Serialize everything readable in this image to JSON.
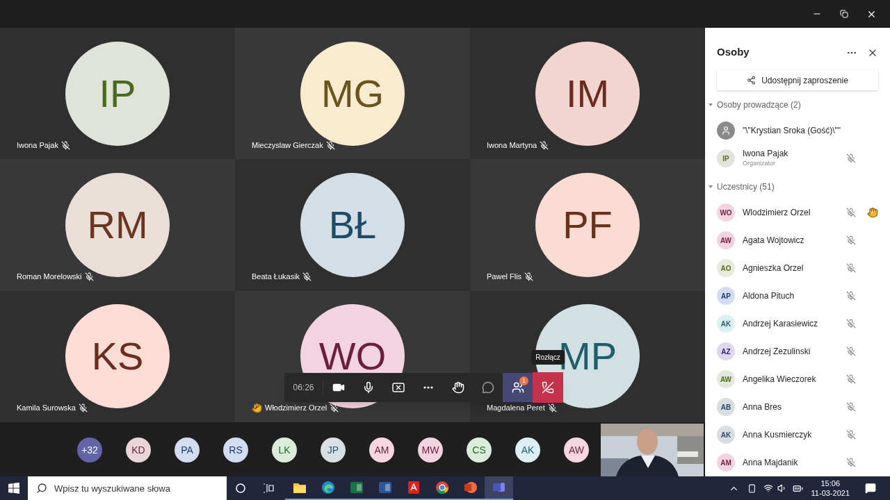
{
  "tiles": [
    {
      "initials": "IP",
      "name": "Iwona Pajak",
      "color": "#dfe3da",
      "muted": true,
      "hand_raised": false
    },
    {
      "initials": "MG",
      "name": "Mieczyslaw Gierczak",
      "color": "#f8ebcf",
      "muted": true,
      "hand_raised": false
    },
    {
      "initials": "IM",
      "name": "Iwona Martyna",
      "color": "#f2d5cf",
      "muted": true,
      "hand_raised": false
    },
    {
      "initials": "RM",
      "name": "Roman Morelowski",
      "color": "#eaded9",
      "muted": true,
      "hand_raised": false
    },
    {
      "initials": "BŁ",
      "name": "Beata Łukasik",
      "color": "#d3dee6",
      "muted": true,
      "hand_raised": false
    },
    {
      "initials": "PF",
      "name": "Pawel Flis",
      "color": "#fbdcd3",
      "muted": true,
      "hand_raised": false
    },
    {
      "initials": "KS",
      "name": "Kamila Surowska",
      "color": "#fcdcd5",
      "muted": true,
      "hand_raised": false
    },
    {
      "initials": "WO",
      "name": "Włodzimierz Orzel",
      "color": "#f4d3e1",
      "muted": true,
      "hand_raised": true
    },
    {
      "initials": "MP",
      "name": "Magdalena Peret",
      "color": "#d2e0e3",
      "muted": true,
      "hand_raised": false
    }
  ],
  "call_controls": {
    "timer": "06:26",
    "tooltip": "Rozłącz",
    "buttons": [
      {
        "kind": "camera",
        "selected": false
      },
      {
        "kind": "mic",
        "selected": false
      },
      {
        "kind": "share",
        "selected": false
      },
      {
        "kind": "more",
        "selected": false
      },
      {
        "kind": "hand",
        "selected": false
      },
      {
        "kind": "chat",
        "selected": false
      },
      {
        "kind": "people",
        "selected": true,
        "badge": "1"
      },
      {
        "kind": "hangup",
        "selected": false
      }
    ]
  },
  "strip": [
    {
      "kind": "overflow",
      "initials": "+32",
      "color": "#6264a7"
    },
    {
      "kind": "person",
      "initials": "KD",
      "color": "#ead6d9"
    },
    {
      "kind": "person",
      "initials": "PA",
      "color": "#d3ddf1"
    },
    {
      "kind": "person",
      "initials": "RS",
      "color": "#d3ddf1"
    },
    {
      "kind": "person",
      "initials": "LK",
      "color": "#dcecdc"
    },
    {
      "kind": "person",
      "initials": "JP",
      "color": "#d8e0e3"
    },
    {
      "kind": "person",
      "initials": "AM",
      "color": "#f7d6e2"
    },
    {
      "kind": "person",
      "initials": "MW",
      "color": "#f4d3e1"
    },
    {
      "kind": "person",
      "initials": "CS",
      "color": "#dcecdc"
    },
    {
      "kind": "person",
      "initials": "AK",
      "color": "#dcf0f3"
    },
    {
      "kind": "person",
      "initials": "AW",
      "color": "#f7d6e2"
    }
  ],
  "panel": {
    "title": "Osoby",
    "invite_button": "Udostępnij zaproszenie",
    "sections": [
      {
        "title": "Osoby prowadzące (2)",
        "expanded": true,
        "people": [
          {
            "kind": "guest",
            "name": "\"\\\"Krystian Sroka (Gość)\\\"\"",
            "muted": false,
            "hand_raised": false
          },
          {
            "kind": "person",
            "initials": "IP",
            "name": "Iwona Pajak",
            "subtitle": "Organizator",
            "color": "#e1e4db",
            "muted": true,
            "hand_raised": false
          }
        ]
      },
      {
        "title": "Uczestnicy (51)",
        "expanded": true,
        "people": [
          {
            "kind": "person",
            "initials": "WO",
            "name": "Wlodzimierz Orzel",
            "color": "#f4d3e1",
            "muted": true,
            "hand_raised": true
          },
          {
            "kind": "person",
            "initials": "AW",
            "name": "Agata Wojtowicz",
            "color": "#f4d3e1",
            "muted": true,
            "hand_raised": false
          },
          {
            "kind": "person",
            "initials": "AO",
            "name": "Agnieszka Orzel",
            "color": "#e6ecdb",
            "muted": true,
            "hand_raised": false
          },
          {
            "kind": "person",
            "initials": "AP",
            "name": "Aldona Pituch",
            "color": "#d3ddf1",
            "muted": true,
            "hand_raised": false
          },
          {
            "kind": "person",
            "initials": "AK",
            "name": "Andrzej Karasiewicz",
            "color": "#dcf0f3",
            "muted": true,
            "hand_raised": false
          },
          {
            "kind": "person",
            "initials": "AZ",
            "name": "Andrzej Zezulinski",
            "color": "#ddd8ef",
            "muted": true,
            "hand_raised": false
          },
          {
            "kind": "person",
            "initials": "AW",
            "name": "Angelika Wieczorek",
            "color": "#e3e8dc",
            "muted": true,
            "hand_raised": false
          },
          {
            "kind": "person",
            "initials": "AB",
            "name": "Anna Bres",
            "color": "#d8dde1",
            "muted": true,
            "hand_raised": false
          },
          {
            "kind": "person",
            "initials": "AK",
            "name": "Anna Kusmierczyk",
            "color": "#d8dde1",
            "muted": true,
            "hand_raised": false
          },
          {
            "kind": "person",
            "initials": "AM",
            "name": "Anna Majdanik",
            "color": "#f4d3e1",
            "muted": true,
            "hand_raised": false
          }
        ]
      }
    ]
  },
  "taskbar": {
    "search_placeholder": "Wpisz tu wyszukiwane słowa",
    "apps": [
      {
        "kind": "folder",
        "selected": false
      },
      {
        "kind": "edge",
        "selected": false
      },
      {
        "kind": "excel",
        "selected": false
      },
      {
        "kind": "word",
        "selected": false
      },
      {
        "kind": "acrobat",
        "selected": false
      },
      {
        "kind": "chrome",
        "selected": false
      },
      {
        "kind": "powerpoint",
        "selected": false
      },
      {
        "kind": "teams",
        "selected": true
      }
    ],
    "time": "15:06",
    "date": "11-03-2021"
  }
}
